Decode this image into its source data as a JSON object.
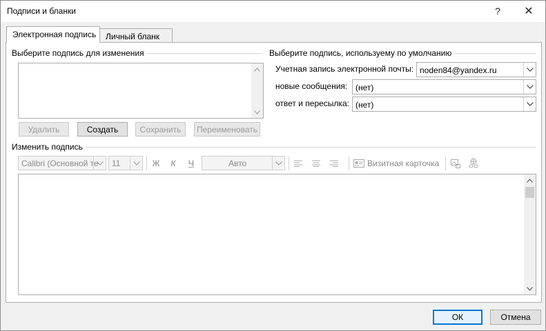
{
  "window": {
    "title": "Подписи и бланки",
    "help_glyph": "?",
    "close_glyph": "✕"
  },
  "tabs": [
    {
      "label": "Электронная подпись",
      "active": true
    },
    {
      "label": "Личный бланк",
      "active": false
    }
  ],
  "select_signature": {
    "label": "Выберите подпись для изменения",
    "items": []
  },
  "signature_buttons": {
    "delete": "Удалить",
    "create": "Создать",
    "save": "Сохранить",
    "rename": "Переименовать"
  },
  "defaults": {
    "label": "Выберите подпись, используему по умолчанию",
    "account_label": "Учетная запись электронной почты:",
    "account_value": "noden84@yandex.ru",
    "new_messages_label": "новые сообщения:",
    "new_messages_value": "(нет)",
    "replies_label": "ответ и пересылка:",
    "replies_value": "(нет)"
  },
  "edit_signature": {
    "label": "Изменить подпись",
    "font": "Calibri (Основной те",
    "size": "11",
    "bold": "Ж",
    "italic": "К",
    "underline": "Ч",
    "color": "Авто",
    "business_card": "Визитная карточка",
    "content": ""
  },
  "footer": {
    "ok": "ОК",
    "cancel": "Отмена"
  },
  "colors": {
    "accent": "#0078d7",
    "border": "#adadad",
    "disabled_text": "#9a9a9a"
  }
}
